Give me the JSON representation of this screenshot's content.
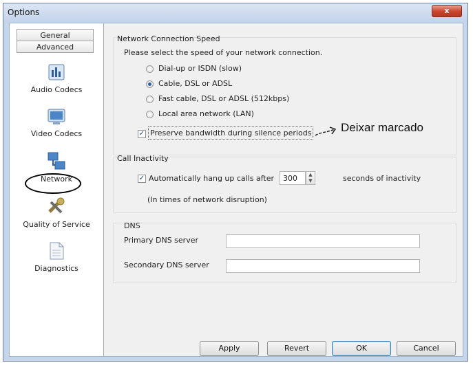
{
  "window": {
    "title": "Options",
    "close_label": "x"
  },
  "sidebar": {
    "tabs": [
      "General",
      "Advanced"
    ],
    "items": [
      {
        "label": "Audio Codecs",
        "icon": "audio-codecs-icon"
      },
      {
        "label": "Video Codecs",
        "icon": "video-codecs-icon"
      },
      {
        "label": "Network",
        "icon": "network-icon"
      },
      {
        "label": "Quality of Service",
        "icon": "quality-of-service-icon"
      },
      {
        "label": "Diagnostics",
        "icon": "diagnostics-icon"
      }
    ]
  },
  "speed": {
    "title": "Network Connection Speed",
    "prompt": "Please select the speed of your network connection.",
    "options": [
      {
        "label": "Dial-up or ISDN (slow)",
        "selected": false
      },
      {
        "label": "Cable, DSL or ADSL",
        "selected": true
      },
      {
        "label": "Fast cable, DSL or ADSL (512kbps)",
        "selected": false
      },
      {
        "label": "Local area network (LAN)",
        "selected": false
      }
    ],
    "preserve_label": "Preserve bandwidth during silence periods",
    "preserve_checked": true
  },
  "inactivity": {
    "title": "Call Inactivity",
    "hangup_label": "Automatically hang up calls after",
    "hangup_checked": true,
    "seconds_value": "300",
    "seconds_suffix": "seconds of inactivity",
    "note": "(In times of network disruption)"
  },
  "dns": {
    "title": "DNS",
    "primary_label": "Primary DNS server",
    "primary_value": "",
    "secondary_label": "Secondary DNS server",
    "secondary_value": ""
  },
  "buttons": {
    "apply": "Apply",
    "revert": "Revert",
    "ok": "OK",
    "cancel": "Cancel"
  },
  "annotation": {
    "text": "Deixar marcado"
  }
}
